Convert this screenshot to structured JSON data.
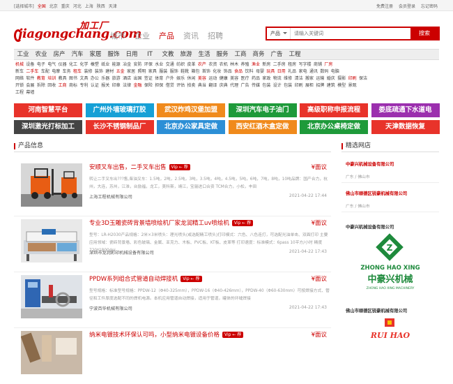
{
  "topbar": {
    "select_city": "[选择城市]",
    "cities": [
      "全国",
      "北京",
      "重庆",
      "河北",
      "上海",
      "陕西",
      "天津"
    ],
    "right_links": [
      "免费注册",
      "会员登录",
      "忘记密码"
    ]
  },
  "logo": {
    "en": "jiagongchang.com",
    "cn": "加工厂"
  },
  "channels": [
    "城市",
    "企业",
    "产品",
    "资讯",
    "招聘"
  ],
  "search": {
    "select": "产品",
    "placeholder": "请输入关键词",
    "button": "搜索"
  },
  "nav": [
    "工业",
    "农业",
    "房产",
    "汽车",
    "家居",
    "服饰",
    "日用",
    "IT",
    "文教",
    "旅游",
    "生活",
    "服务",
    "工商",
    "商务",
    "广告",
    "工程"
  ],
  "tag_rows": [
    [
      "机械",
      "设备",
      "电子",
      "电气",
      "仪器",
      "化工",
      "化学",
      "橡塑",
      "纸业",
      "能源",
      "冶金",
      "安防",
      "环保",
      "水业",
      "交通",
      "纺织",
      "皮革",
      "农产",
      "农资",
      "农机",
      "林木",
      "养殖",
      "渔业",
      "新房",
      "二手房",
      "租房",
      "写字楼",
      "商铺",
      "厂房"
    ],
    [
      "新车",
      "二手车",
      "车配",
      "电摩",
      "车务",
      "租车",
      "装修",
      "装饰",
      "建材",
      "五金",
      "家居",
      "照明",
      "家具",
      "服装",
      "服饰",
      "鞋靴",
      "箱包",
      "首饰",
      "化妆",
      "饰品",
      "食品",
      "饮料",
      "母婴",
      "玩具",
      "日用",
      "礼品",
      "家电",
      "通讯",
      "数码",
      "电脑"
    ],
    [
      "网络",
      "软件",
      "教育",
      "培训",
      "教具",
      "图书",
      "文具",
      "办公",
      "乐器",
      "旅游",
      "酒店",
      "出国",
      "签证",
      "体育",
      "户外",
      "娱乐",
      "休闲",
      "美容",
      "运动",
      "健康",
      "美容",
      "医疗",
      "药品",
      "家政",
      "物流",
      "维修",
      "清洁",
      "搬家",
      "运输",
      "婚庆",
      "摄影",
      "印刷",
      "保洁"
    ],
    [
      "开锁",
      "会展",
      "拆除",
      "回收",
      "工商",
      "商标",
      "专利",
      "认证",
      "报关",
      "印章",
      "法律",
      "金融",
      "保险",
      "担保",
      "借贷",
      "评估",
      "拍卖",
      "典当",
      "翻译",
      "庆典",
      "代理",
      "广告",
      "传媒",
      "包装",
      "设计",
      "包装",
      "印刷",
      "展柜",
      "招牌",
      "建筑",
      "模型",
      "景观"
    ],
    [
      "工程",
      "幕墙"
    ]
  ],
  "tag_red": {
    "0": [
      1,
      0,
      0,
      0,
      0,
      0,
      0,
      0,
      0,
      0,
      0,
      0,
      0,
      0,
      0,
      0,
      0,
      1,
      0,
      0,
      0,
      0,
      1,
      0,
      0,
      0,
      0,
      0,
      1
    ],
    "1": [
      0,
      1,
      0,
      0,
      0,
      1,
      0,
      0,
      0,
      1,
      0,
      0,
      0,
      0,
      0,
      0,
      0,
      0,
      0,
      0,
      1,
      0,
      0,
      1,
      1,
      0,
      0,
      0,
      0,
      0
    ],
    "2": [
      0,
      0,
      1,
      1,
      0,
      0,
      0,
      0,
      0,
      0,
      0,
      0,
      0,
      0,
      0,
      0,
      0,
      1,
      0,
      0,
      0,
      0,
      0,
      0,
      0,
      0,
      0,
      0,
      0,
      0,
      0,
      1,
      0
    ],
    "3": [
      0,
      0,
      0,
      0,
      1,
      0,
      0,
      0,
      0,
      0,
      0,
      1,
      0,
      0,
      0,
      0,
      0,
      0,
      0,
      0,
      0,
      0,
      0,
      0,
      0,
      0,
      0,
      0,
      0,
      0,
      0,
      0
    ]
  },
  "banners": [
    {
      "text": "河南智慧平台",
      "bg": "#e8332a"
    },
    {
      "text": "广州外墙玻璃打胶",
      "bg": "#16a0d6"
    },
    {
      "text": "武汉炸鸡汉堡加盟",
      "bg": "#f08a1c"
    },
    {
      "text": "深圳汽车电子油门",
      "bg": "#1e9a3a"
    },
    {
      "text": "高级职称申报流程",
      "bg": "#e8332a"
    },
    {
      "text": "娄底疏通下水道电",
      "bg": "#9b2fae"
    },
    {
      "text": "深圳激光打标加工",
      "bg": "#444444"
    },
    {
      "text": "长沙不锈钢制品厂",
      "bg": "#e8332a"
    },
    {
      "text": "北京办公家具定做",
      "bg": "#2c8fd6"
    },
    {
      "text": "西安红酒木盒定做",
      "bg": "#f08a1c"
    },
    {
      "text": "北京办公桌椅定做",
      "bg": "#1e9a3a"
    },
    {
      "text": "天津数据恢复",
      "bg": "#e8332a"
    }
  ],
  "products_head": "产品信息",
  "products": [
    {
      "title": "安顺叉车出售，二手叉车出售",
      "vip": "Vip ← 荐",
      "price": "¥面议",
      "desc": "转让二手叉车出???售,柴油叉车：1.5吨，2吨，2.5吨，3吨，3.5吨，4吨，4.5吨，5吨，6吨，7吨，8吨，10吨品牌：国产合力，杭州，大连，苏州，江淮，台励福，龙工，美科斯，靖江，宝骊进口合资 TCM合力，小松，丰田",
      "company": "上海工程机械有限公司",
      "time": "2021-04-22 17:44"
    },
    {
      "title": "专业3D玉雕瓷砖背景墙喷绘机厂家龙润精工uv喷绘机",
      "vip": "Vip ← 荐",
      "price": "¥面议",
      "desc": "型号：LR-H2030产品规格：2米×3米喷头：理光喷头(或选配精工喷头)打印模式：六色、八色连打，可选配光油单击、双面打印 主要应用领域：瓷砖背景墙、彩色玻璃、金属、亚克力、木板、PVC板、KT板、皮革等 打印速度：标准模式：6pass 10平方/小时 精度720*1800dpi",
      "company": "深圳市龙润彩印机械设备有限公司",
      "time": "2021-04-22 17:43"
    },
    {
      "title": "PPDW系列组合式管道自动焊接机",
      "vip": "Vip ← 荐",
      "price": "¥面议",
      "desc": "型号规格：标准型号规格：PPDW-12（Φ40-325mm），PPDW-16（Φ40-426mm），PPDW-40（Φ60-630mm）可按焊接方式、管径和工件厚度选配不同的焊机电源。本机应用管道自动焊接，适用于管道，罐体的环缝焊接",
      "company": "宁波百华机械有限公司",
      "time": "2021-04-22 17:43"
    },
    {
      "title": "纳米电镀技术环保认可吗，小型纳米电镀设备价格",
      "vip": "Vip ← 荐",
      "price": "¥面议",
      "desc": "",
      "company": "",
      "time": ""
    }
  ],
  "shops_head": "精选网店",
  "shops": [
    {
      "name": "中豪兴机械设备有限公司",
      "loc": "广东 / 佛山市"
    },
    {
      "name": "佛山市顺德区锐豪机械有限公司",
      "loc": "广东 / 佛山市"
    }
  ],
  "feature_shops": [
    {
      "name": "中豪兴机械设备有限公司",
      "logo_en": "ZHONG HAO XING",
      "logo_cn": "中豪兴机械",
      "logo_sub": "ZHONG HAO XING MACHINERY"
    },
    {
      "name": "佛山市顺德区锐豪机械有限公司",
      "logo_en": "RUI HAO"
    }
  ],
  "colors": {
    "brand": "#cc0000",
    "gray_nav": "#eeeeee"
  }
}
